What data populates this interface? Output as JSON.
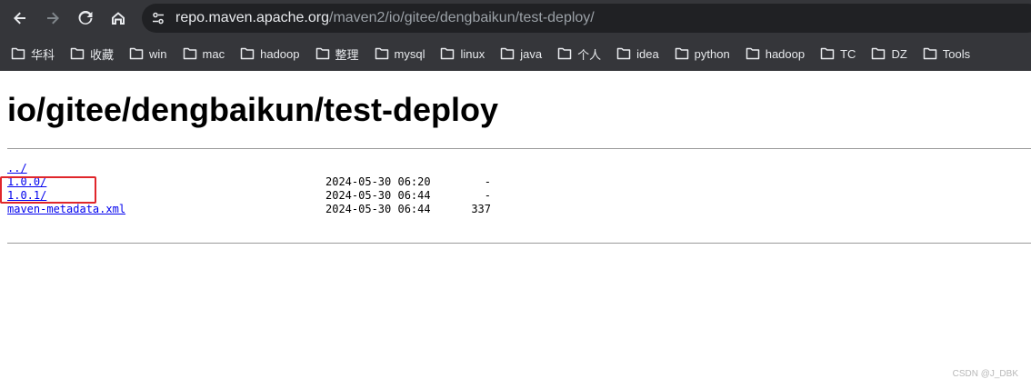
{
  "browser": {
    "url_host": "repo.maven.apache.org",
    "url_path": "/maven2/io/gitee/dengbaikun/test-deploy/",
    "icons": {
      "back": "arrow-left-icon",
      "forward": "arrow-right-icon",
      "reload": "reload-icon",
      "home": "home-icon",
      "site_info": "tune-icon",
      "bookmark": "folder-icon"
    },
    "colors": {
      "chrome": "#35363a",
      "omnibox": "#202124",
      "text": "#e8eaed"
    },
    "bookmarks": [
      "华科",
      "收藏",
      "win",
      "mac",
      "hadoop",
      "整理",
      "mysql",
      "linux",
      "java",
      "个人",
      "idea",
      "python",
      "hadoop",
      "TC",
      "DZ",
      "Tools"
    ]
  },
  "page": {
    "title": "io/gitee/dengbaikun/test-deploy",
    "entries": [
      {
        "name": "../",
        "date": "",
        "size": ""
      },
      {
        "name": "1.0.0/",
        "date": "2024-05-30 06:20",
        "size": "-"
      },
      {
        "name": "1.0.1/",
        "date": "2024-05-30 06:44",
        "size": "-"
      },
      {
        "name": "maven-metadata.xml",
        "date": "2024-05-30 06:44",
        "size": "337"
      }
    ],
    "link_color": "#0000ee",
    "highlight_color": "#e0262b"
  },
  "watermark": "CSDN @J_DBK"
}
